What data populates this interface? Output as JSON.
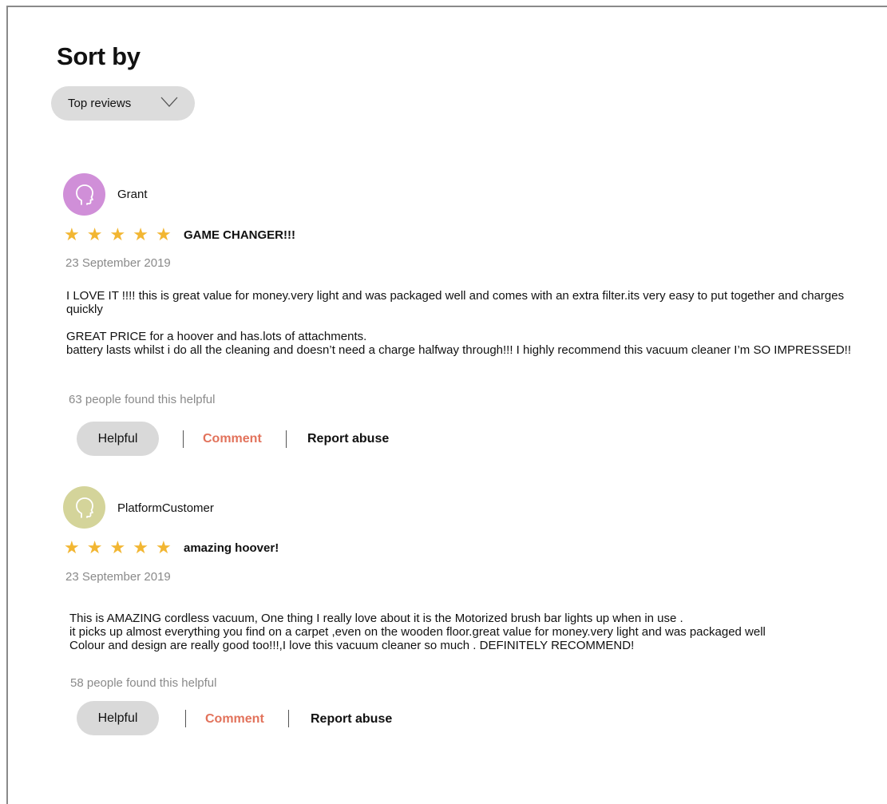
{
  "sort": {
    "title": "Sort by",
    "selected": "Top reviews",
    "chevron_icon": "chevron-down-icon"
  },
  "colors": {
    "star": "#f2b632",
    "comment_link": "#e2725b",
    "muted_text": "#8a8a8a",
    "button_bg": "#d9d9d9"
  },
  "reviews": [
    {
      "reviewer": "Grant",
      "avatar_color": "#d08fd8",
      "avatar_icon": "person-head-icon",
      "rating": 5,
      "title": "GAME CHANGER!!!",
      "date": "23 September 2019",
      "body": [
        "I LOVE IT !!!! this is great value for money.very light and was packaged well and comes with an extra filter.its very easy to put together and charges quickly",
        "",
        "GREAT PRICE for a hoover and has.lots of attachments.",
        "battery lasts whilst i do all the cleaning and doesn’t need a charge halfway through!!! I highly recommend this vacuum cleaner I’m SO IMPRESSED!!"
      ],
      "helpful_count": "63 people found this helpful",
      "helpful_label": "Helpful",
      "comment_label": "Comment",
      "report_label": "Report abuse"
    },
    {
      "reviewer": "PlatformCustomer",
      "avatar_color": "#d4d49a",
      "avatar_icon": "person-head-icon",
      "rating": 5,
      "title": "amazing hoover!",
      "date": "23 September 2019",
      "body": [
        "This is AMAZING cordless vacuum, One thing I really love about it is the Motorized brush bar lights up when in use .",
        "it picks up almost everything you  find on a carpet ,even on the wooden floor.great value for money.very light and was packaged well",
        "Colour and design are really good too!!!,I love this vacuum cleaner so much . DEFINITELY RECOMMEND!"
      ],
      "helpful_count": "58 people found this helpful",
      "helpful_label": "Helpful",
      "comment_label": "Comment",
      "report_label": "Report abuse"
    }
  ]
}
